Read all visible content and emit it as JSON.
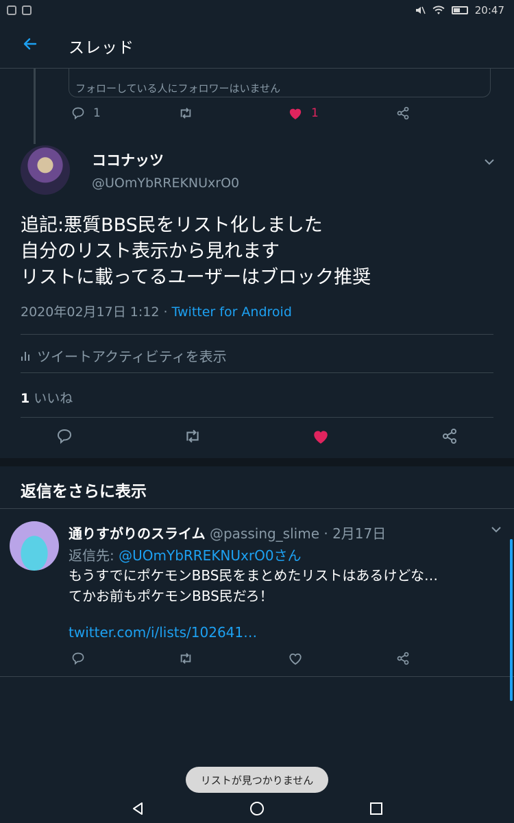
{
  "status_bar": {
    "time": "20:47"
  },
  "header": {
    "title": "スレッド"
  },
  "prev_tweet": {
    "quote_text": "フォローしている人にフォロワーはいません",
    "reply_count": "1",
    "like_count": "1"
  },
  "main_tweet": {
    "name": "ココナッツ",
    "handle": "@UOmYbRREKNUxrO0",
    "text_line1": "追記:悪質BBS民をリスト化しました",
    "text_line2": "自分のリスト表示から見れます",
    "text_line3": "リストに載ってるユーザーはブロック推奨",
    "date": "2020年02月17日 1:12 · ",
    "source": "Twitter for Android",
    "activity_label": "ツイートアクティビティを表示",
    "likes_count": "1",
    "likes_label": " いいね"
  },
  "more_replies_label": "返信をさらに表示",
  "reply_tweet": {
    "name": "通りすがりのスライム",
    "handle_date": " @passing_slime · 2月17日",
    "reply_to_prefix": "返信先: ",
    "reply_to_mention": "@UOmYbRREKNUxrO0さん",
    "text_line1": "もうすでにポケモンBBS民をまとめたリストはあるけどな…",
    "text_line2": "てかお前もポケモンBBS民だろ！",
    "link": "twitter.com/i/lists/102641…"
  },
  "toast": "リストが見つかりません",
  "colors": {
    "background": "#15202b",
    "accent": "#1da1f2",
    "like": "#e0245e",
    "muted": "#8899a6"
  }
}
